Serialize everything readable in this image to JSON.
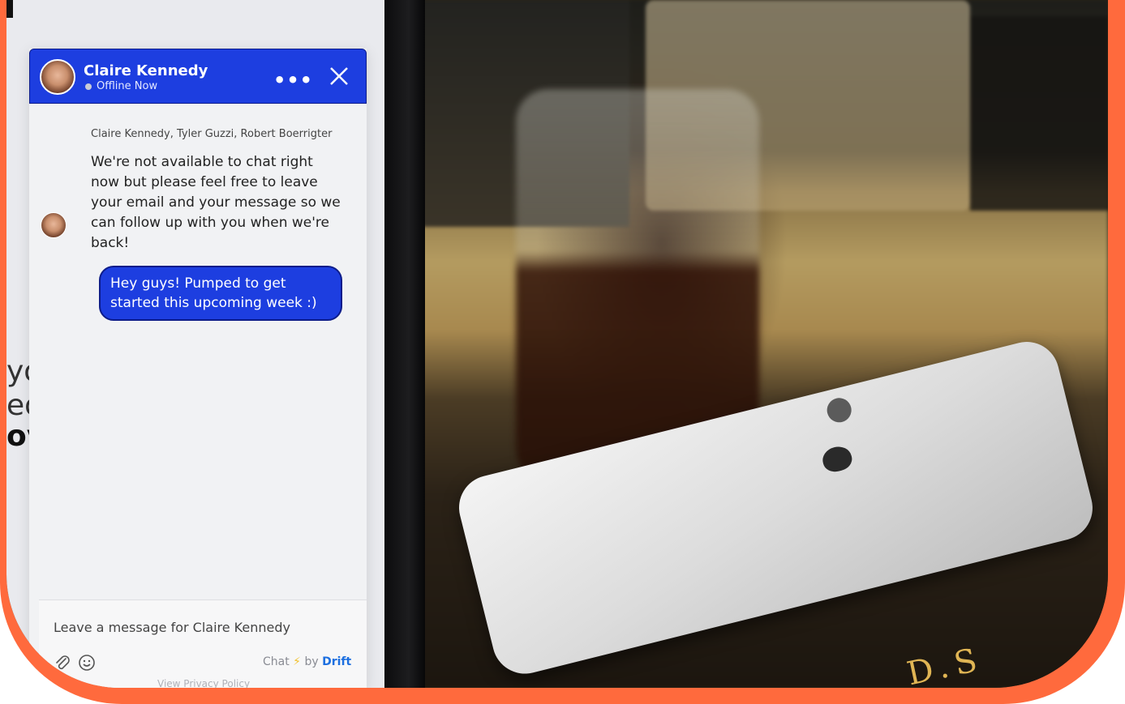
{
  "chat": {
    "agent_name": "Claire Kennedy",
    "agent_status": "Offline Now",
    "participants": "Claire Kennedy, Tyler Guzzi, Robert Boerrigter",
    "agent_message": "We're not available to chat right now but please feel free to leave your email and your message so we can follow up with you when we're back!",
    "user_message": "Hey guys! Pumped to get started this upcoming week :)",
    "composer_placeholder": "Leave a message for Claire Kennedy",
    "branding_chat": "Chat",
    "branding_by": "by",
    "branding_drift": "Drift",
    "privacy_link": "View Privacy Policy"
  },
  "background": {
    "edge_text": [
      "you",
      "eo",
      "ov"
    ],
    "book_text": "D.S"
  },
  "colors": {
    "frame": "#ff6a3d",
    "chat_accent": "#1d3ee0",
    "drift_brand": "#1d6fe0"
  }
}
